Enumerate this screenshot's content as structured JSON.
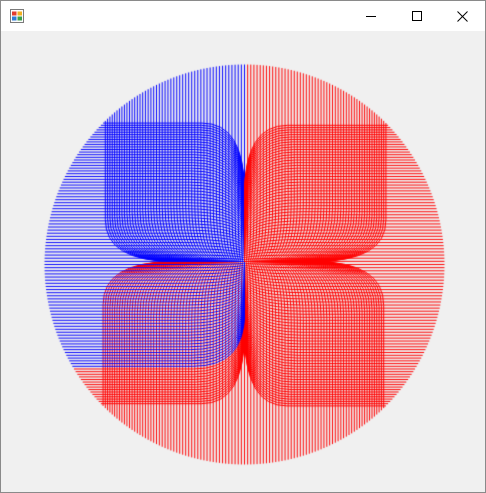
{
  "window": {
    "title": "",
    "icon": "winforms-app-icon",
    "controls": {
      "minimize": "minimize-icon",
      "maximize": "maximize-icon",
      "close": "close-icon"
    }
  },
  "drawing": {
    "background": "#f0f0f0",
    "colors": {
      "blue": "#0000ff",
      "red": "#ff0000"
    },
    "line_count": 400,
    "blue_fraction": 0.33
  }
}
